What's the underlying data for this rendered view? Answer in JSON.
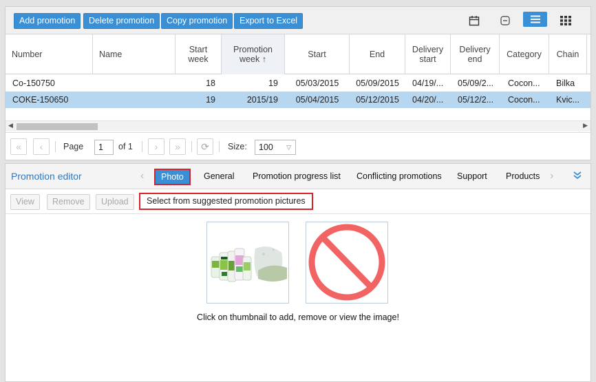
{
  "toolbar": {
    "add_label": "Add promotion",
    "delete_label": "Delete promotion",
    "copy_label": "Copy promotion",
    "export_label": "Export to Excel",
    "icons": [
      "calendar-icon",
      "collapse-icon",
      "list-view-icon",
      "grid-view-icon"
    ],
    "accent_color": "#3b8fd4"
  },
  "grid": {
    "columns": [
      {
        "label": "Number"
      },
      {
        "label": "Name"
      },
      {
        "label": "Start week"
      },
      {
        "label": "Promotion week ↑"
      },
      {
        "label": "Start"
      },
      {
        "label": "End"
      },
      {
        "label": "Delivery start"
      },
      {
        "label": "Delivery end"
      },
      {
        "label": "Category"
      },
      {
        "label": "Chain"
      }
    ],
    "rows": [
      {
        "number": "Co-150750",
        "name": "",
        "start_week": "18",
        "promotion_week": "19",
        "start": "05/03/2015",
        "end": "05/09/2015",
        "delivery_start": "04/19/...",
        "delivery_end": "05/09/2...",
        "category": "Cocon...",
        "chain": "Bilka"
      },
      {
        "number": "COKE-150650",
        "name": "",
        "start_week": "19",
        "promotion_week": "2015/19",
        "start": "05/04/2015",
        "end": "05/12/2015",
        "delivery_start": "04/20/...",
        "delivery_end": "05/12/2...",
        "category": "Cocon...",
        "chain": "Kvic..."
      }
    ],
    "selected_row_index": 1
  },
  "pager": {
    "page_label": "Page",
    "page_value": "1",
    "of_label": "of 1",
    "size_label": "Size:",
    "size_value": "100"
  },
  "editor": {
    "title": "Promotion editor",
    "tabs": [
      "Photo",
      "General",
      "Promotion progress list",
      "Conflicting promotions",
      "Support",
      "Products"
    ],
    "active_tab": "Photo",
    "view_label": "View",
    "remove_label": "Remove",
    "upload_label": "Upload",
    "suggest_label": "Select from suggested promotion pictures",
    "hint": "Click on thumbnail to add, remove or view the image!",
    "thumbnails": [
      "product-photo-thumbnail",
      "no-image-icon"
    ]
  }
}
